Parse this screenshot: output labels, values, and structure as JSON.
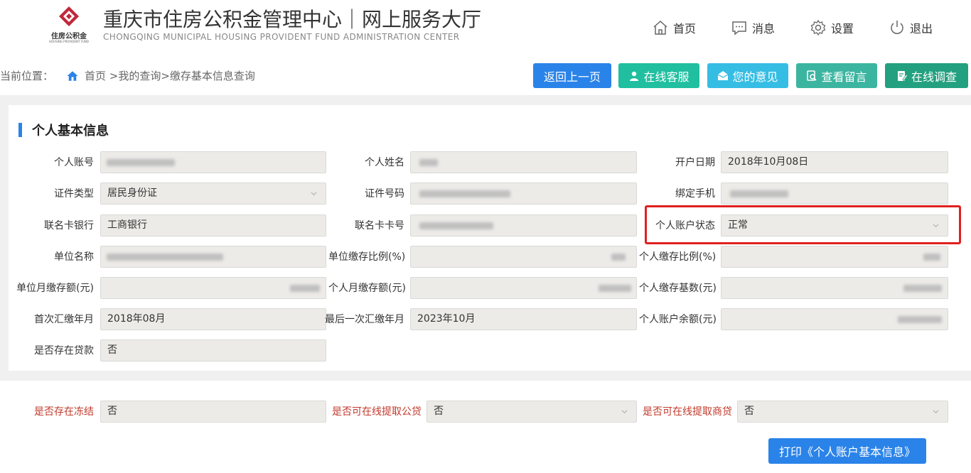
{
  "header": {
    "logo_text": "住房公积金",
    "logo_subtext": "HOUSING PROVIDENT FUND",
    "title_cn": "重庆市住房公积金管理中心｜网上服务大厅",
    "title_en": "CHONGQING MUNICIPAL HOUSING PROVIDENT FUND ADMINISTRATION CENTER",
    "nav": [
      {
        "label": "首页",
        "icon": "home-icon"
      },
      {
        "label": "消息",
        "icon": "message-icon"
      },
      {
        "label": "设置",
        "icon": "gear-icon"
      },
      {
        "label": "退出",
        "icon": "power-icon"
      }
    ]
  },
  "breadcrumb": {
    "prefix": "当前位置：",
    "path": "首页 >我的查询>缴存基本信息查询"
  },
  "toolbar": {
    "back": "返回上一页",
    "service": "在线客服",
    "feedback": "您的意见",
    "messages": "查看留言",
    "survey": "在线调查"
  },
  "section": {
    "title": "个人基本信息"
  },
  "fields": {
    "account_no": {
      "label": "个人账号",
      "value": ""
    },
    "name": {
      "label": "个人姓名",
      "value": ""
    },
    "open_date": {
      "label": "开户日期",
      "value": "2018年10月08日"
    },
    "id_type": {
      "label": "证件类型",
      "value": "居民身份证"
    },
    "id_no": {
      "label": "证件号码",
      "value": ""
    },
    "phone": {
      "label": "绑定手机",
      "value": ""
    },
    "bank": {
      "label": "联名卡银行",
      "value": "工商银行"
    },
    "card_no": {
      "label": "联名卡卡号",
      "value": ""
    },
    "status": {
      "label": "个人账户状态",
      "value": "正常"
    },
    "unit_name": {
      "label": "单位名称",
      "value": ""
    },
    "unit_ratio": {
      "label": "单位缴存比例(%)",
      "value": ""
    },
    "personal_ratio": {
      "label": "个人缴存比例(%)",
      "value": ""
    },
    "unit_monthly": {
      "label": "单位月缴存额(元)",
      "value": ""
    },
    "personal_monthly": {
      "label": "个人月缴存额(元)",
      "value": ""
    },
    "personal_base": {
      "label": "个人缴存基数(元)",
      "value": ""
    },
    "first_month": {
      "label": "首次汇缴年月",
      "value": "2018年08月"
    },
    "last_month": {
      "label": "最后一次汇缴年月",
      "value": "2023年10月"
    },
    "balance": {
      "label": "个人账户余额(元)",
      "value": ""
    },
    "has_loan": {
      "label": "是否存在贷款",
      "value": "否"
    }
  },
  "extra": {
    "frozen": {
      "label": "是否存在冻结",
      "value": "否"
    },
    "withdraw_public": {
      "label": "是否可在线提取公贷",
      "value": "否"
    },
    "withdraw_commercial": {
      "label": "是否可在线提取商贷",
      "value": "否"
    }
  },
  "print_button": "打印《个人账户基本信息》",
  "colors": {
    "back": "#2a83e8",
    "service": "#1fbfa0",
    "feedback": "#36bde3",
    "messages": "#3bb5a0",
    "survey": "#23a07f",
    "highlight": "#e02020",
    "logo": "#c0283a"
  }
}
